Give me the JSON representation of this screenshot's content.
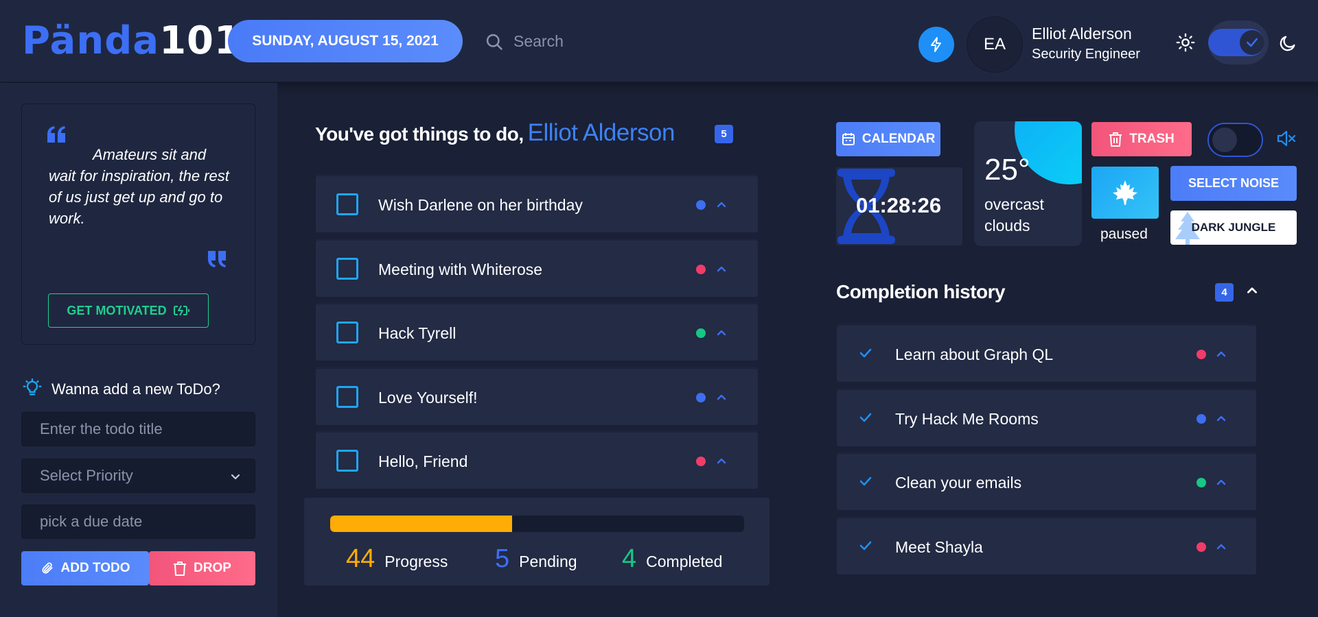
{
  "header": {
    "logo_part1": "Pända",
    "logo_part2": "101",
    "date": "SUNDAY, AUGUST 15, 2021",
    "search_placeholder": "Search",
    "user": {
      "initials": "EA",
      "name": "Elliot Alderson",
      "role": "Security Engineer"
    },
    "theme_toggle_on": true
  },
  "sidebar": {
    "quote": "Amateurs sit and wait for inspiration, the rest of us just get up and go to work.",
    "motivate_label": "GET MOTIVATED",
    "add_title": "Wanna add a new ToDo?",
    "title_placeholder": "Enter the todo title",
    "priority_placeholder": "Select Priority",
    "date_placeholder": "pick a due date",
    "add_label": "ADD TODO",
    "drop_label": "DROP"
  },
  "todos": {
    "heading": "You've got things to do,",
    "name": "Elliot Alderson",
    "count": "5",
    "items": [
      {
        "label": "Wish Darlene on her birthday",
        "priority_color": "#3d6ff0"
      },
      {
        "label": "Meeting with Whiterose",
        "priority_color": "#f23b68"
      },
      {
        "label": "Hack Tyrell",
        "priority_color": "#17c784"
      },
      {
        "label": "Love Yourself!",
        "priority_color": "#3d6ff0"
      },
      {
        "label": "Hello, Friend",
        "priority_color": "#f23b68"
      }
    ]
  },
  "progress": {
    "percent": 44,
    "value": "44",
    "value_label": "Progress",
    "pending": "5",
    "pending_label": "Pending",
    "completed": "4",
    "completed_label": "Completed"
  },
  "widgets": {
    "calendar_label": "CALENDAR",
    "timer": "01:28:26",
    "temperature": "25°",
    "condition": "overcast clouds",
    "trash_label": "TRASH",
    "sound_on": false,
    "season_icon": "maple-leaf-icon",
    "player_status": "paused",
    "select_noise_label": "SELECT NOISE",
    "noise_name": "DARK JUNGLE"
  },
  "history": {
    "title": "Completion history",
    "count": "4",
    "items": [
      {
        "label": "Learn about Graph QL",
        "priority_color": "#f23b68"
      },
      {
        "label": "Try Hack Me Rooms",
        "priority_color": "#3d6ff0"
      },
      {
        "label": "Clean your emails",
        "priority_color": "#17c784"
      },
      {
        "label": "Meet Shayla",
        "priority_color": "#f23b68"
      }
    ]
  },
  "colors": {
    "accent_blue": "#3c6ff5",
    "danger_pink": "#f2557a",
    "success_green": "#1fcf8f",
    "progress_orange": "#ffad06",
    "background": "#1a2035"
  }
}
